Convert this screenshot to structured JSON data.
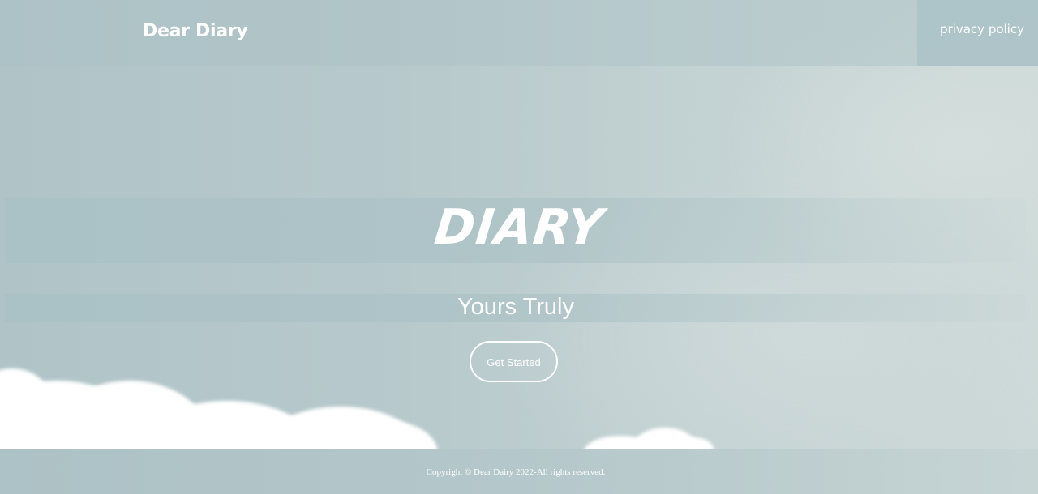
{
  "navbar": {
    "brand": "Dear Diary",
    "links": [
      {
        "label": "privacy policy"
      }
    ]
  },
  "hero": {
    "title": "DIARY",
    "subtitle": "Yours Truly",
    "cta_label": "Get Started"
  },
  "footer": {
    "copyright": "Copyright © Dear Dairy 2022-All rights reserved."
  },
  "colors": {
    "background": "#b6c8cb",
    "text": "#ffffff",
    "band": "#a8c0c5"
  },
  "icons": []
}
